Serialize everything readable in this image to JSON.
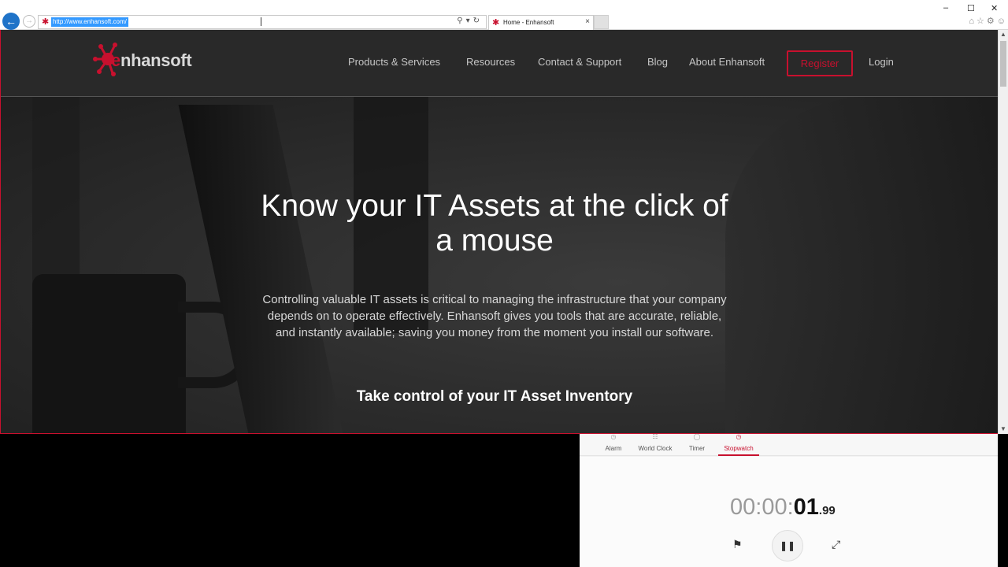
{
  "browser": {
    "url": "http://www.enhansoft.com/",
    "tab_title": "Home - Enhansoft",
    "back_icon": "back-arrow-icon",
    "forward_icon": "forward-arrow-icon"
  },
  "site": {
    "brand": "nhansoft",
    "brand_initial": "e",
    "nav": [
      "Products & Services",
      "Resources",
      "Contact & Support",
      "Blog",
      "About Enhansoft"
    ],
    "register": "Register",
    "login": "Login",
    "accent_color": "#c8102e"
  },
  "hero": {
    "headline": "Know your IT Assets at the click of a mouse",
    "body": "Controlling valuable IT assets is critical to managing the infrastructure that your company depends on to operate effectively. Enhansoft gives you tools that are accurate, reliable, and instantly available; saving you money from the moment you install our software.",
    "cta": "Take control of your IT Asset Inventory"
  },
  "clock_app": {
    "tabs": [
      "Alarm",
      "World Clock",
      "Timer",
      "Stopwatch"
    ],
    "active_tab": "Stopwatch",
    "time_hours_minutes": "00:00:",
    "time_seconds": "01",
    "time_fraction": ".99",
    "buttons": [
      "flag-icon",
      "pause-icon",
      "expand-icon"
    ]
  }
}
